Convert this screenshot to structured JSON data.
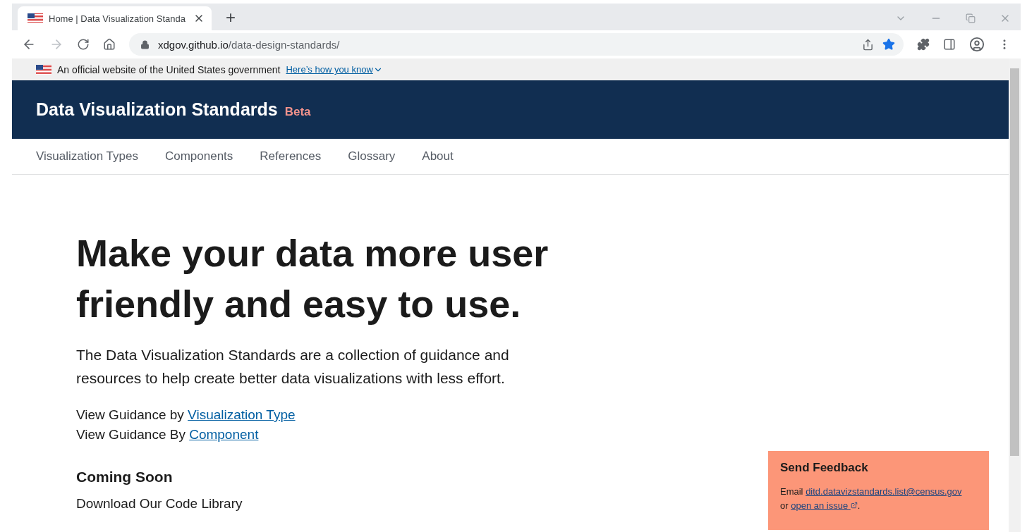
{
  "browser": {
    "tab_title": "Home | Data Visualization Standa",
    "new_tab": "+",
    "url_host": "xdgov.github.io",
    "url_path": "/data-design-standards/",
    "bookmarked": true
  },
  "gov_banner": {
    "text": "An official website of the United States government",
    "link": "Here’s how you know"
  },
  "header": {
    "title": "Data Visualization Standards",
    "badge": "Beta"
  },
  "nav": [
    {
      "label": "Visualization Types",
      "selected": false
    },
    {
      "label": "Components",
      "selected": false
    },
    {
      "label": "References",
      "selected": false
    },
    {
      "label": "Glossary",
      "selected": false
    },
    {
      "label": "About",
      "selected": false
    }
  ],
  "hero": {
    "headline": "Make your data more user friendly and easy to use.",
    "intro": "The Data Visualization Standards are a collection of guidance and resources to help create better data visualizations with less effort.",
    "guidance": [
      {
        "text": "View Guidance by",
        "link": "Visualization Type"
      },
      {
        "text": "View Guidance By",
        "link": "Component"
      }
    ],
    "coming_soon": {
      "heading": "Coming Soon",
      "item": "Download Our Code Library"
    }
  },
  "feedback": {
    "title": "Send Feedback",
    "email_label": "Email",
    "email": "ditd.datavizstandards.list@census.gov",
    "or": "or",
    "issue_link": "open an issue",
    "end": "."
  }
}
